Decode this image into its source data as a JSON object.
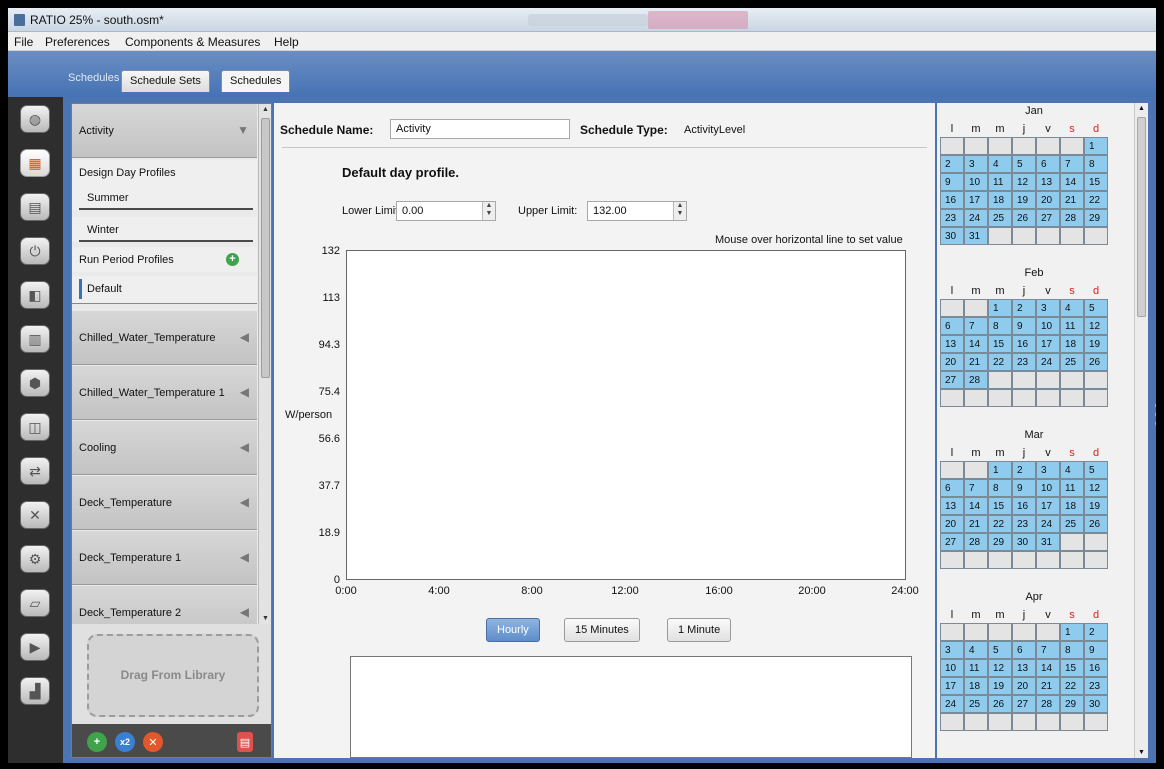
{
  "window": {
    "title": "RATIO 25% - south.osm*"
  },
  "menu": [
    "File",
    "Preferences",
    "Components & Measures",
    "Help"
  ],
  "tabs": {
    "section": "Schedules",
    "items": [
      "Schedule Sets",
      "Schedules"
    ],
    "selected": "Schedules"
  },
  "sidebar_icons": [
    "site-icon",
    "schedules-icon",
    "constructions-icon",
    "loads-icon",
    "space-types-icon",
    "facility-icon",
    "spaces-icon",
    "thermal-zones-icon",
    "hvac-systems-icon",
    "building-summary-icon",
    "scripts-icon",
    "simulation-settings-icon",
    "run-icon",
    "results-icon"
  ],
  "schedule_list": {
    "items": [
      "Activity",
      "Design Day Profiles",
      "Summer",
      "Winter",
      "Run Period Profiles",
      "Default",
      "Chilled_Water_Temperature",
      "Chilled_Water_Temperature 1",
      "Cooling",
      "Deck_Temperature",
      "Deck_Temperature 1",
      "Deck_Temperature 2"
    ],
    "drop_label": "Drag From Library"
  },
  "editor": {
    "name_label": "Schedule Name:",
    "name_value": "Activity",
    "type_label": "Schedule Type:",
    "type_value": "ActivityLevel",
    "profile_title": "Default day profile.",
    "lower_label": "Lower Limit:",
    "lower_value": "0.00",
    "upper_label": "Upper Limit:",
    "upper_value": "132.00",
    "hint": "Mouse over horizontal line to set value",
    "y_unit": "W/person",
    "y_ticks": [
      "132",
      "113",
      "94.3",
      "75.4",
      "56.6",
      "37.7",
      "18.9",
      "0"
    ],
    "x_ticks": [
      "0:00",
      "4:00",
      "8:00",
      "12:00",
      "16:00",
      "20:00",
      "24:00"
    ],
    "resolution_buttons": [
      "Hourly",
      "15 Minutes",
      "1 Minute"
    ],
    "selected_resolution": "Hourly"
  },
  "calendar": {
    "dow": [
      "l",
      "m",
      "m",
      "j",
      "v",
      "s",
      "d"
    ],
    "months": [
      {
        "name": "Jan",
        "start": 6,
        "days": 31
      },
      {
        "name": "Feb",
        "start": 2,
        "days": 28
      },
      {
        "name": "Mar",
        "start": 2,
        "days": 31
      },
      {
        "name": "Apr",
        "start": 5,
        "days": 30
      }
    ],
    "colors": {
      "day_cell": "#8fcbed",
      "weekend_header": "#dd2222"
    }
  }
}
